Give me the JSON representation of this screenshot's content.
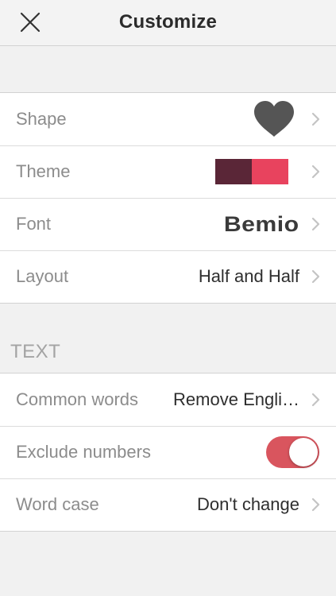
{
  "header": {
    "title": "Customize",
    "close_icon": "close-icon"
  },
  "shape_group": {
    "rows": [
      {
        "label": "Shape",
        "value_icon": "heart-icon",
        "value_color": "#555555"
      },
      {
        "label": "Theme",
        "swatch_colors": [
          "#5a2637",
          "#e8435e"
        ]
      },
      {
        "label": "Font",
        "value": "Bemio"
      },
      {
        "label": "Layout",
        "value": "Half and Half"
      }
    ]
  },
  "text_section": {
    "header": "TEXT",
    "rows": [
      {
        "label": "Common words",
        "value": "Remove Engli…"
      },
      {
        "label": "Exclude numbers",
        "toggle_on": true,
        "toggle_color": "#d9555e"
      },
      {
        "label": "Word case",
        "value": "Don't change"
      }
    ]
  },
  "chevron_icon": "chevron-right-icon"
}
